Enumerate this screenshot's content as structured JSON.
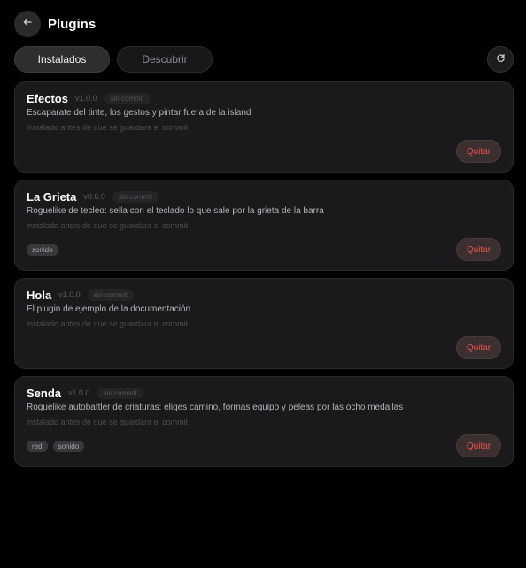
{
  "header": {
    "title": "Plugins",
    "back_icon": "arrow-left-icon"
  },
  "tabs": [
    {
      "label": "Instalados",
      "active": true
    },
    {
      "label": "Descubrir",
      "active": false
    }
  ],
  "toolbar": {
    "refresh_icon": "refresh-icon"
  },
  "colors": {
    "background": "#000000",
    "card": "#1a1a1c",
    "remove": "#e5534b"
  },
  "plugins": [
    {
      "name": "Efectos",
      "version": "v1.0.0",
      "commit": "sin commit",
      "description": "Escaparate del tinte, los gestos y pintar fuera de la island",
      "install_note": "instalado antes de que se guardara el commit",
      "tags": [],
      "remove_label": "Quitar"
    },
    {
      "name": "La Grieta",
      "version": "v0.6.0",
      "commit": "sin commit",
      "description": "Roguelike de tecleo: sella con el teclado lo que sale por la grieta de la barra",
      "install_note": "instalado antes de que se guardara el commit",
      "tags": [
        "sonido"
      ],
      "remove_label": "Quitar"
    },
    {
      "name": "Hola",
      "version": "v1.0.0",
      "commit": "sin commit",
      "description": "El plugin de ejemplo de la documentación",
      "install_note": "instalado antes de que se guardara el commit",
      "tags": [],
      "remove_label": "Quitar"
    },
    {
      "name": "Senda",
      "version": "v1.0.0",
      "commit": "sin commit",
      "description": "Roguelike autobattler de criaturas: eliges camino, formas equipo y peleas por las ocho medallas",
      "install_note": "instalado antes de que se guardara el commit",
      "tags": [
        "red",
        "sonido"
      ],
      "remove_label": "Quitar"
    }
  ]
}
